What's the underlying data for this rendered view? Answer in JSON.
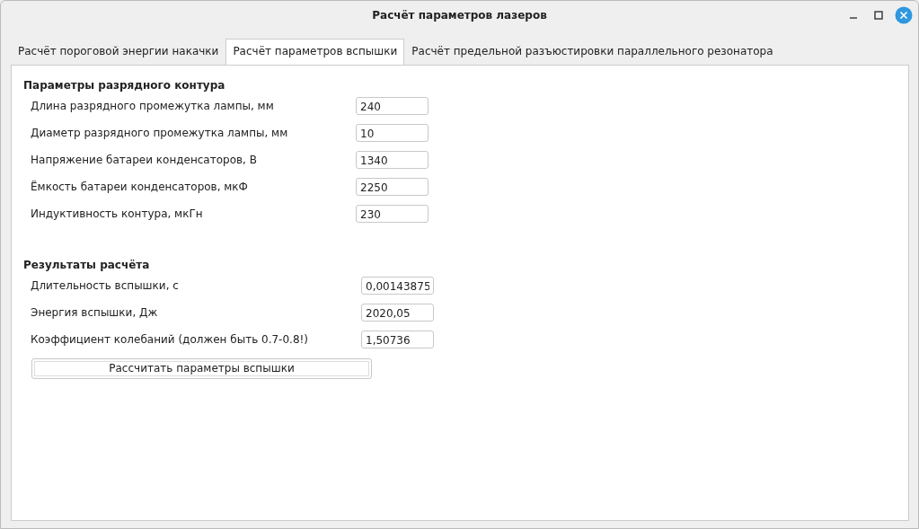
{
  "window": {
    "title": "Расчёт параметров лазеров"
  },
  "tabs": [
    {
      "label": "Расчёт пороговой энергии накачки",
      "selected": false
    },
    {
      "label": "Расчёт параметров вспышки",
      "selected": true
    },
    {
      "label": "Расчёт предельной разъюстировки параллельного резонатора",
      "selected": false
    }
  ],
  "sections": [
    {
      "title": "Параметры разрядного контура",
      "fields": [
        {
          "label": "Длина разрядного промежутка лампы, мм",
          "value": "240"
        },
        {
          "label": "Диаметр разрядного промежутка лампы, мм",
          "value": "10"
        },
        {
          "label": "Напряжение батареи конденсаторов, В",
          "value": "1340"
        },
        {
          "label": "Ёмкость батареи конденсаторов, мкФ",
          "value": "2250"
        },
        {
          "label": "Индуктивность контура, мкГн",
          "value": "230"
        }
      ]
    },
    {
      "title": "Результаты расчёта",
      "fields": [
        {
          "label": "Длительность вспышки, с",
          "value": "0,00143875"
        },
        {
          "label": "Энергия вспышки, Дж",
          "value": "2020,05"
        },
        {
          "label": "Коэффициент колебаний (должен быть 0.7-0.8!)",
          "value": "1,50736"
        }
      ]
    }
  ],
  "button": {
    "label": "Рассчитать параметры вспышки"
  }
}
